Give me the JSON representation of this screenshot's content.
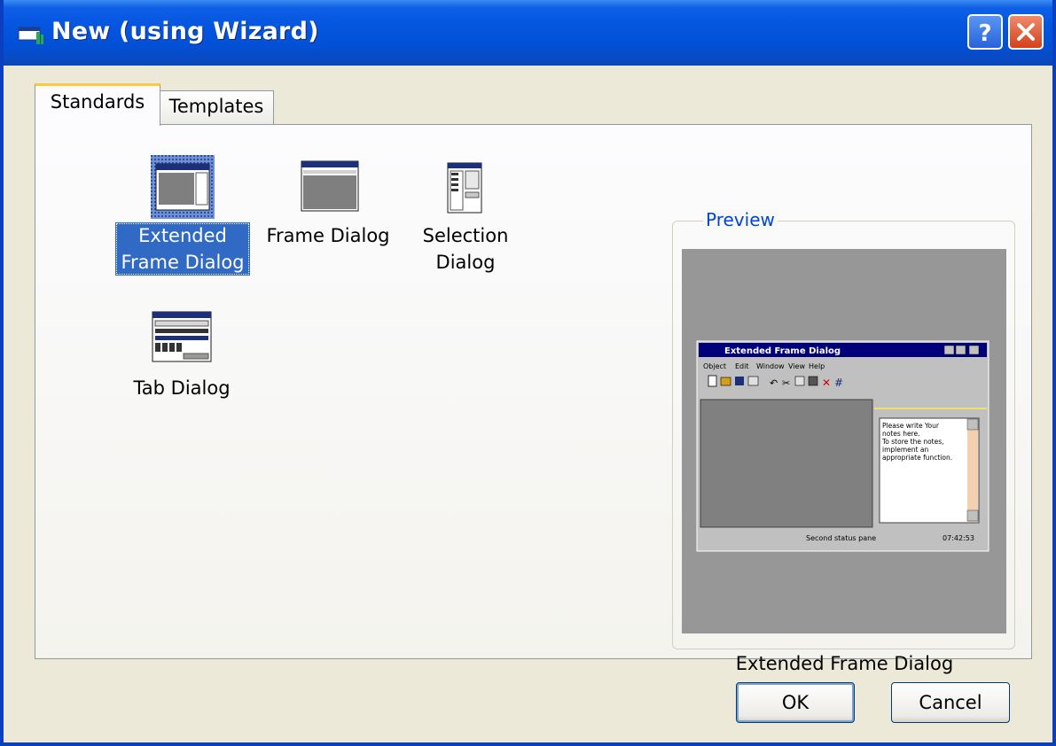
{
  "window": {
    "title": "New (using Wizard)"
  },
  "tabs": [
    {
      "label": "Standards",
      "active": true
    },
    {
      "label": "Templates",
      "active": false
    }
  ],
  "items": [
    {
      "label": "Extended\nFrame Dialog",
      "selected": true,
      "icon": "extended-frame-dialog-icon"
    },
    {
      "label": "Frame Dialog",
      "selected": false,
      "icon": "frame-dialog-icon"
    },
    {
      "label": "Selection\nDialog",
      "selected": false,
      "icon": "selection-dialog-icon"
    },
    {
      "label": "Tab Dialog",
      "selected": false,
      "icon": "tab-dialog-icon"
    }
  ],
  "preview": {
    "legend": "Preview",
    "caption": "Extended Frame Dialog",
    "mini": {
      "title": "Extended Frame Dialog",
      "menu": [
        "Object",
        "Edit",
        "Window",
        "View",
        "Help"
      ],
      "note_lines": [
        "Please write Your",
        "notes here.",
        "To store the notes,",
        "implement an",
        "appropriate function."
      ],
      "status_pane": "Second status pane",
      "status_time": "07:42:53"
    }
  },
  "buttons": {
    "ok": "OK",
    "cancel": "Cancel"
  },
  "colors": {
    "titlebar": "#0455e0",
    "selection": "#316ac5",
    "preview_bg": "#979797",
    "legend_text": "#0046d5"
  }
}
